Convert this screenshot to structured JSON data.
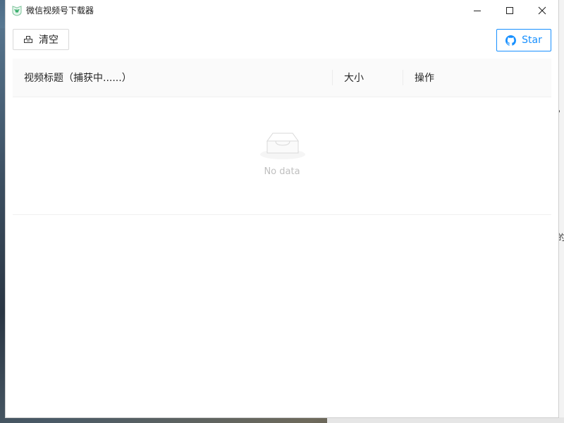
{
  "window": {
    "title": "微信视频号下载器"
  },
  "toolbar": {
    "clear_label": "清空",
    "star_label": "Star"
  },
  "table": {
    "columns": [
      "视频标题（捕获中......）",
      "大小",
      "操作"
    ],
    "rows": [],
    "empty_text": "No data"
  },
  "colors": {
    "accent": "#1890ff",
    "header_bg": "#fafafa",
    "border": "#d9d9d9",
    "empty_text": "#bfbfbf"
  },
  "icons": {
    "app": "wechat-channels-icon",
    "clear": "clear-icon",
    "star": "github-icon",
    "empty": "empty-inbox-icon"
  },
  "background": {
    "edge_chars": [
      "，",
      "的"
    ]
  }
}
